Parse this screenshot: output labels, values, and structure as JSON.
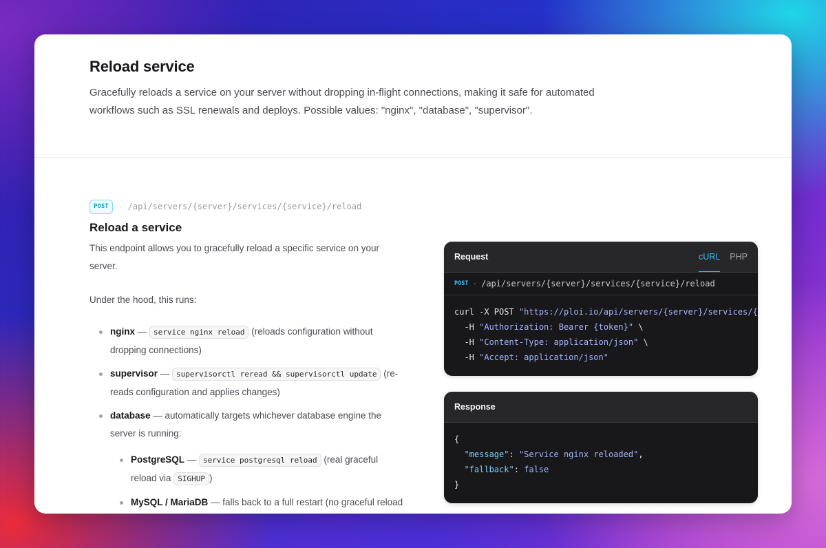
{
  "header": {
    "title": "Reload service",
    "description": "Gracefully reloads a service on your server without dropping in-flight connections, making it safe for automated workflows such as SSL renewals and deploys. Possible values: \"nginx\", \"database\", \"supervisor\"."
  },
  "endpoint": {
    "method": "POST",
    "separator": "·",
    "path": "/api/servers/{server}/services/{service}/reload"
  },
  "section": {
    "title": "Reload a service",
    "description": "This endpoint allows you to gracefully reload a specific service on your server.",
    "under_hood": "Under the hood, this runs:"
  },
  "items": [
    {
      "name": "nginx",
      "dash": " — ",
      "code": "service nginx reload",
      "text": " (reloads configuration without dropping connections)"
    },
    {
      "name": "supervisor",
      "dash": " — ",
      "code": "supervisorctl reread && supervisorctl update",
      "text": " (re-reads configuration and applies changes)"
    },
    {
      "name": "database",
      "text": " — automatically targets whichever database engine the server is running:"
    }
  ],
  "sub_items": [
    {
      "name": "PostgreSQL",
      "dash": " — ",
      "code": "service postgresql reload",
      "text_before": " (real graceful reload via ",
      "code2": "SIGHUP",
      "text_after": ")"
    },
    {
      "name": "MySQL / MariaDB",
      "text": " — falls back to a full restart (no graceful reload"
    }
  ],
  "request_panel": {
    "title": "Request",
    "tabs": [
      "cURL",
      "PHP"
    ],
    "active_tab": "cURL",
    "method": "POST",
    "separator": "·",
    "path": "/api/servers/{server}/services/{service}/reload",
    "code": {
      "line1_cmd": "curl -X POST ",
      "line1_url": "\"https://ploi.io/api/servers/{server}/services/{service}/reload\"",
      "line1_end": " \\",
      "line2_flag": "  -H ",
      "line2_val": "\"Authorization: Bearer {token}\"",
      "line2_end": " \\",
      "line3_flag": "  -H ",
      "line3_val": "\"Content-Type: application/json\"",
      "line3_end": " \\",
      "line4_flag": "  -H ",
      "line4_val": "\"Accept: application/json\""
    }
  },
  "response_panel": {
    "title": "Response",
    "code": {
      "open": "{",
      "key1": "\"message\"",
      "colon": ": ",
      "val1": "\"Service nginx reloaded\"",
      "comma": ",",
      "key2": "\"fallback\"",
      "val2": "false",
      "close": "}"
    }
  },
  "colors": {
    "accent": "#38bdf8",
    "badge_text": "#0ea5c6",
    "panel_bg": "#18181b",
    "panel_header": "#27272a"
  }
}
